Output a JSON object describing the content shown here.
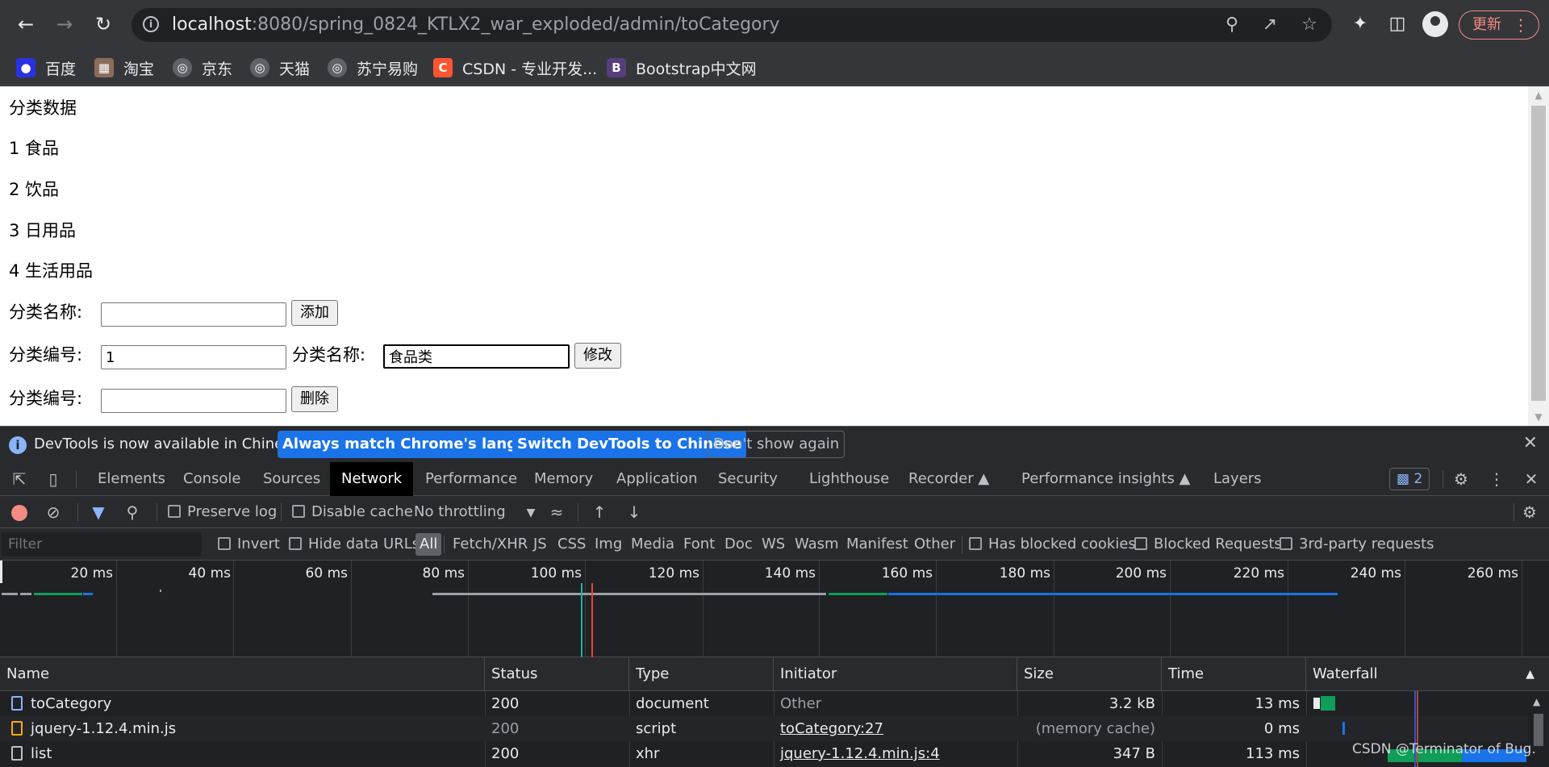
{
  "browser": {
    "url_host": "localhost",
    "url_rest": ":8080/spring_0824_KTLX2_war_exploded/admin/toCategory",
    "update_label": "更新",
    "bookmarks": [
      "百度",
      "淘宝",
      "京东",
      "天猫",
      "苏宁易购",
      "CSDN - 专业开发...",
      "Bootstrap中文网"
    ]
  },
  "page": {
    "heading": "分类数据",
    "categories": [
      "1 食品",
      "2 饮品",
      "3 日用品",
      "4 生活用品"
    ],
    "add_label": "分类名称:",
    "add_value": "",
    "add_button": "添加",
    "edit_id_label": "分类编号:",
    "edit_id_value": "1",
    "edit_name_label": "分类名称:",
    "edit_name_value": "食品类",
    "edit_button": "修改",
    "delete_label": "分类编号:",
    "delete_value": "",
    "delete_button": "删除"
  },
  "devtools": {
    "infobar": {
      "message": "DevTools is now available in Chinese!",
      "btn_match": "Always match Chrome's language",
      "btn_switch": "Switch DevTools to Chinese",
      "btn_dismiss": "Don't show again"
    },
    "tabs": [
      "Elements",
      "Console",
      "Sources",
      "Network",
      "Performance",
      "Memory",
      "Application",
      "Security",
      "Lighthouse",
      "Recorder",
      "Performance insights",
      "Layers"
    ],
    "active_tab": "Network",
    "issues_count": "2",
    "toolbar": {
      "preserve_log": "Preserve log",
      "disable_cache": "Disable cache",
      "throttling": "No throttling"
    },
    "filter": {
      "placeholder": "Filter",
      "invert": "Invert",
      "hide_data_urls": "Hide data URLs",
      "types": [
        "All",
        "Fetch/XHR",
        "JS",
        "CSS",
        "Img",
        "Media",
        "Font",
        "Doc",
        "WS",
        "Wasm",
        "Manifest",
        "Other"
      ],
      "active_type": "All",
      "blocked_cookies": "Has blocked cookies",
      "blocked_requests": "Blocked Requests",
      "third_party": "3rd-party requests"
    },
    "timeline_ticks": [
      "20 ms",
      "40 ms",
      "60 ms",
      "80 ms",
      "100 ms",
      "120 ms",
      "140 ms",
      "160 ms",
      "180 ms",
      "200 ms",
      "220 ms",
      "240 ms",
      "260 ms"
    ],
    "columns": [
      "Name",
      "Status",
      "Type",
      "Initiator",
      "Size",
      "Time",
      "Waterfall"
    ],
    "rows": [
      {
        "name": "toCategory",
        "status": "200",
        "type": "document",
        "initiator": "Other",
        "size": "3.2 kB",
        "time": "13 ms"
      },
      {
        "name": "jquery-1.12.4.min.js",
        "status": "200",
        "type": "script",
        "initiator": "toCategory:27",
        "size": "(memory cache)",
        "time": "0 ms"
      },
      {
        "name": "list",
        "status": "200",
        "type": "xhr",
        "initiator": "jquery-1.12.4.min.js:4",
        "size": "347 B",
        "time": "113 ms"
      }
    ]
  },
  "watermark": "CSDN @Terminator of Bug.",
  "colors": {
    "accent": "#1a73e8",
    "record": "#f28b82",
    "chrome_bg": "#35363a",
    "devtools_bg": "#202124"
  }
}
